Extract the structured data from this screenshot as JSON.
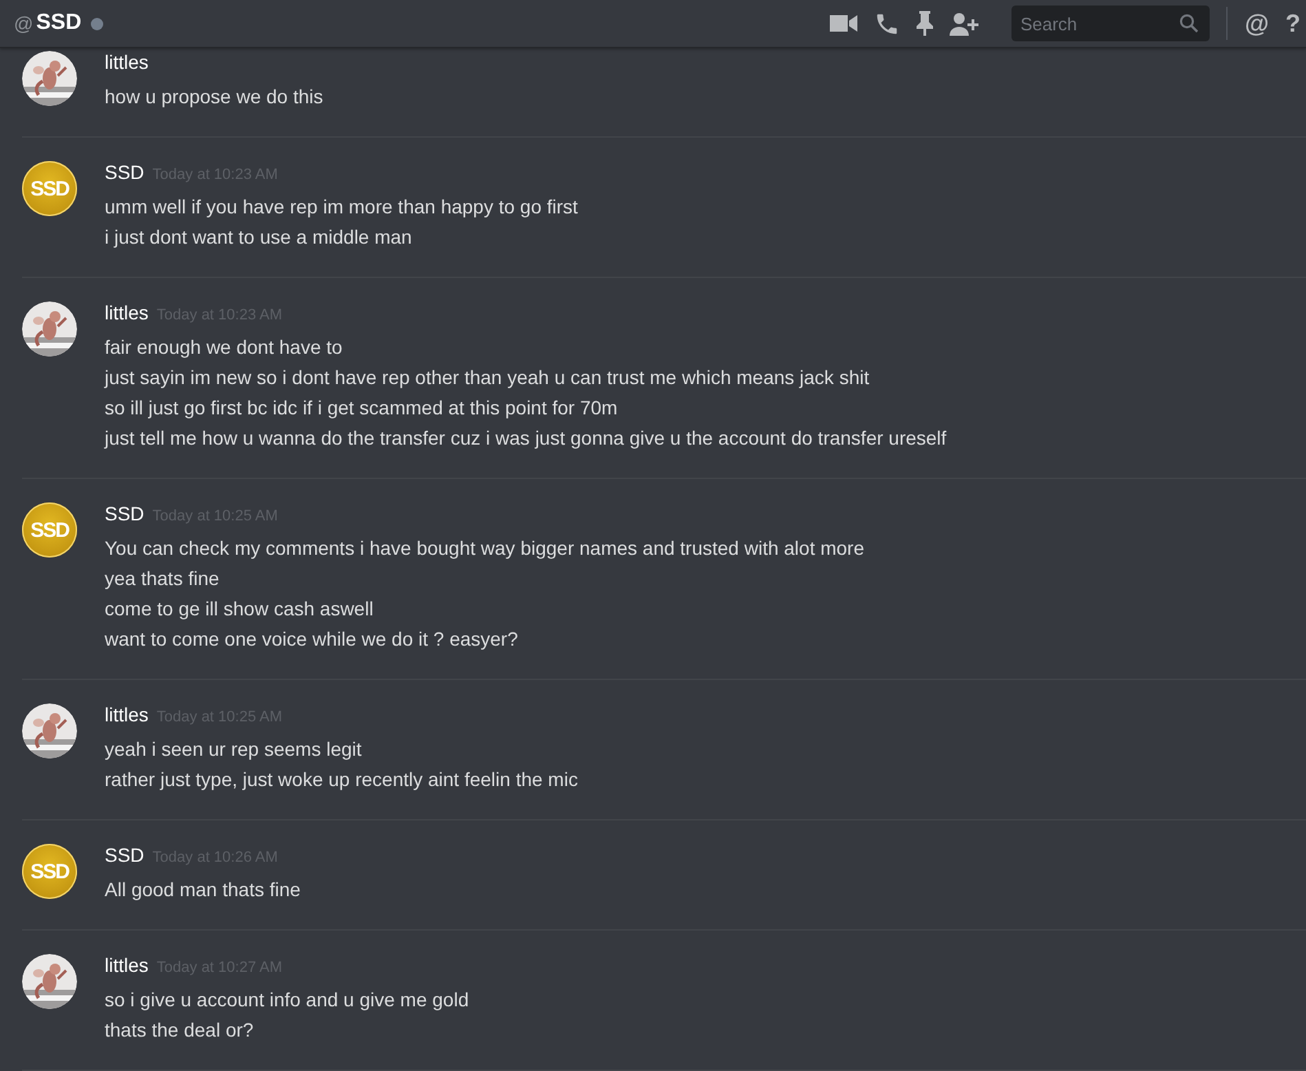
{
  "header": {
    "prefix": "@",
    "title": "SSD",
    "online": false,
    "search": {
      "placeholder": "Search"
    },
    "mention_glyph": "@",
    "help_glyph": "?"
  },
  "messages": [
    {
      "author": "littles",
      "avatar": {
        "kind": "picture"
      },
      "lines": [
        "how u propose we do this"
      ]
    },
    {
      "author": "SSD",
      "avatar": {
        "kind": "badge",
        "text": "SSD"
      },
      "time": "Today at 10:23 AM",
      "lines": [
        "umm well if you have rep im more than happy to go first",
        "i just dont want to use a middle man"
      ]
    },
    {
      "author": "littles",
      "avatar": {
        "kind": "picture"
      },
      "time": "Today at 10:23 AM",
      "lines": [
        "fair enough we dont have to",
        "just sayin im new so i dont have rep other than yeah u can trust me which means jack shit",
        "so ill just go first bc idc if i get scammed at this point for 70m",
        "just tell me how u wanna do the transfer cuz i was just gonna give u the account do transfer ureself"
      ]
    },
    {
      "author": "SSD",
      "avatar": {
        "kind": "badge",
        "text": "SSD"
      },
      "time": "Today at 10:25 AM",
      "lines": [
        "You can check my comments i have bought way bigger names and trusted with alot more",
        "yea thats fine",
        "come to ge ill show cash aswell",
        "want to come one voice while we do it ? easyer?"
      ]
    },
    {
      "author": "littles",
      "avatar": {
        "kind": "picture"
      },
      "time": "Today at 10:25 AM",
      "lines": [
        "yeah i seen ur rep seems legit",
        "rather just type, just woke up recently aint feelin the mic"
      ]
    },
    {
      "author": "SSD",
      "avatar": {
        "kind": "badge",
        "text": "SSD"
      },
      "time": "Today at 10:26 AM",
      "lines": [
        "All good man thats fine"
      ]
    },
    {
      "author": "littles",
      "avatar": {
        "kind": "picture"
      },
      "time": "Today at 10:27 AM",
      "lines": [
        "so i give u account info and u give me gold",
        "thats the deal or?"
      ]
    }
  ]
}
